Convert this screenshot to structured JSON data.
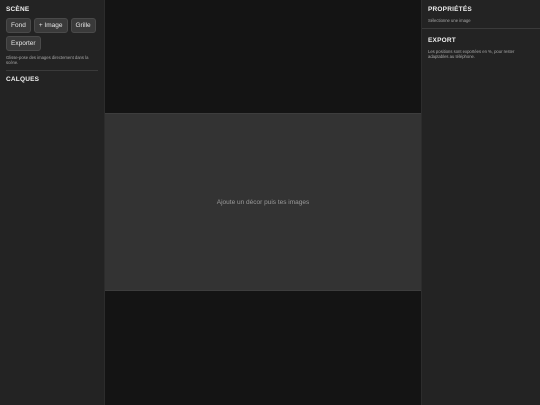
{
  "left": {
    "scene_title": "SCÈNE",
    "buttons": {
      "fond": "Fond",
      "add_image": "+ Image",
      "grille": "Grille",
      "exporter": "Exporter"
    },
    "hint": "Glisse-pose des images directement dans la scène.",
    "layers_title": "CALQUES"
  },
  "center": {
    "placeholder": "Ajoute un décor puis tes images"
  },
  "right": {
    "properties_title": "PROPRIÉTÉS",
    "properties_hint": "Sélectionne une image",
    "export_title": "EXPORT",
    "export_hint": "Les positions sont exportées en %, pour rester adaptables au téléphone."
  }
}
